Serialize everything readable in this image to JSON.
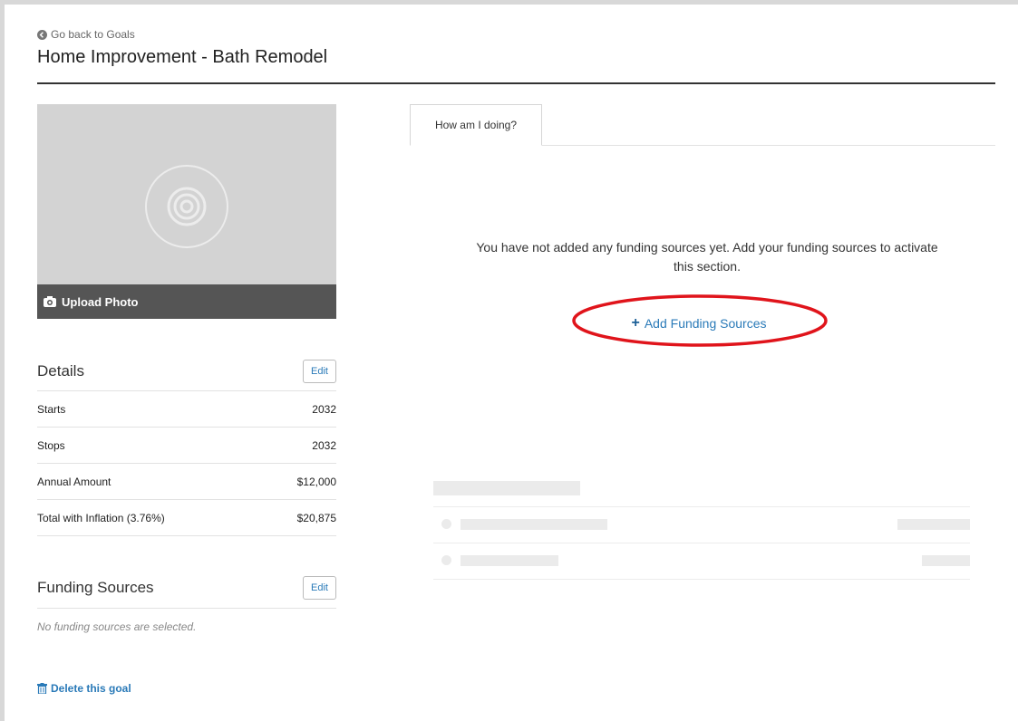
{
  "header": {
    "back_label": "Go back to Goals",
    "title": "Home Improvement - Bath Remodel"
  },
  "photo": {
    "upload_label": "Upload Photo"
  },
  "details": {
    "title": "Details",
    "edit_label": "Edit",
    "rows": [
      {
        "label": "Starts",
        "value": "2032"
      },
      {
        "label": "Stops",
        "value": "2032"
      },
      {
        "label": "Annual Amount",
        "value": "$12,000"
      },
      {
        "label": "Total with Inflation (3.76%)",
        "value": "$20,875"
      }
    ]
  },
  "funding": {
    "title": "Funding Sources",
    "edit_label": "Edit",
    "empty_text": "No funding sources are selected."
  },
  "delete_label": "Delete this goal",
  "tabs": [
    {
      "label": "How am I doing?",
      "active": true
    }
  ],
  "main": {
    "empty_message": "You have not added any funding sources yet. Add your funding sources to activate this section.",
    "add_label": "Add Funding Sources"
  },
  "colors": {
    "link": "#2a7ab8",
    "highlight": "#e0141b"
  }
}
